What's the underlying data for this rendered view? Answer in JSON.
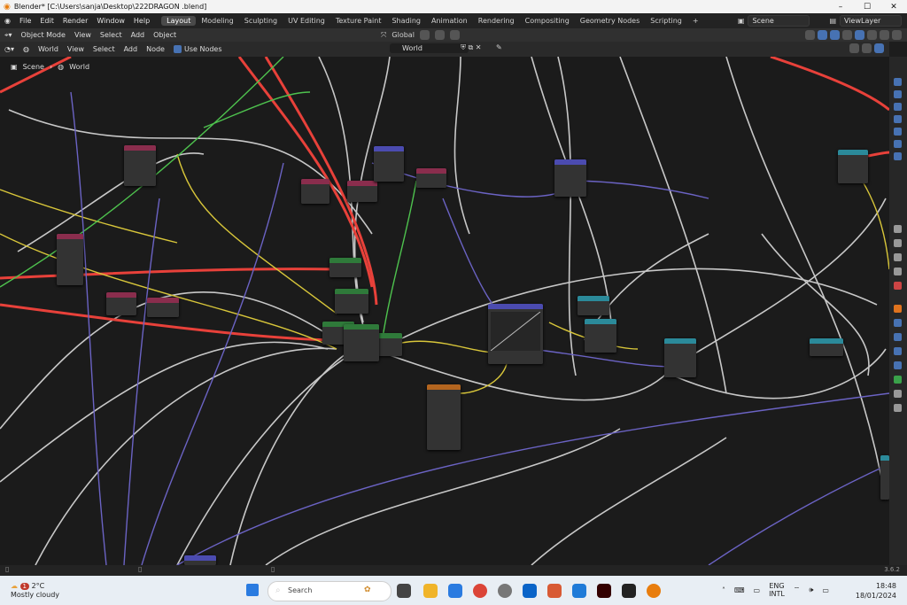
{
  "window": {
    "title": "Blender* [C:\\Users\\sanja\\Desktop\\222DRAGON .blend]"
  },
  "menubar": {
    "items": [
      "File",
      "Edit",
      "Render",
      "Window",
      "Help"
    ],
    "workspaces": [
      "Layout",
      "Modeling",
      "Sculpting",
      "UV Editing",
      "Texture Paint",
      "Shading",
      "Animation",
      "Rendering",
      "Compositing",
      "Geometry Nodes",
      "Scripting"
    ],
    "active_workspace": "Layout",
    "scene": "Scene",
    "view_layer": "ViewLayer"
  },
  "toolbar": {
    "mode": "Object Mode",
    "items": [
      "View",
      "Select",
      "Add",
      "Object"
    ],
    "transform": "Global"
  },
  "node_header": {
    "shader_type": "World",
    "items": [
      "View",
      "Select",
      "Add",
      "Node"
    ],
    "use_nodes_label": "Use Nodes",
    "use_nodes_checked": true,
    "world_name": "World"
  },
  "breadcrumb": [
    "Scene",
    "World"
  ],
  "statusbar": {
    "version": "3.6.2"
  },
  "taskbar": {
    "weather_temp": "2°C",
    "weather_desc": "Mostly cloudy",
    "weather_badge": "1",
    "search_label": "Search",
    "lang_1": "ENG",
    "lang_2": "INTL",
    "time": "18:48",
    "date": "18/01/2024",
    "accent_colors": {
      "blender": "#e87d0d",
      "red_wire": "#e8413a",
      "active_tab": "#4a4a4a"
    }
  }
}
